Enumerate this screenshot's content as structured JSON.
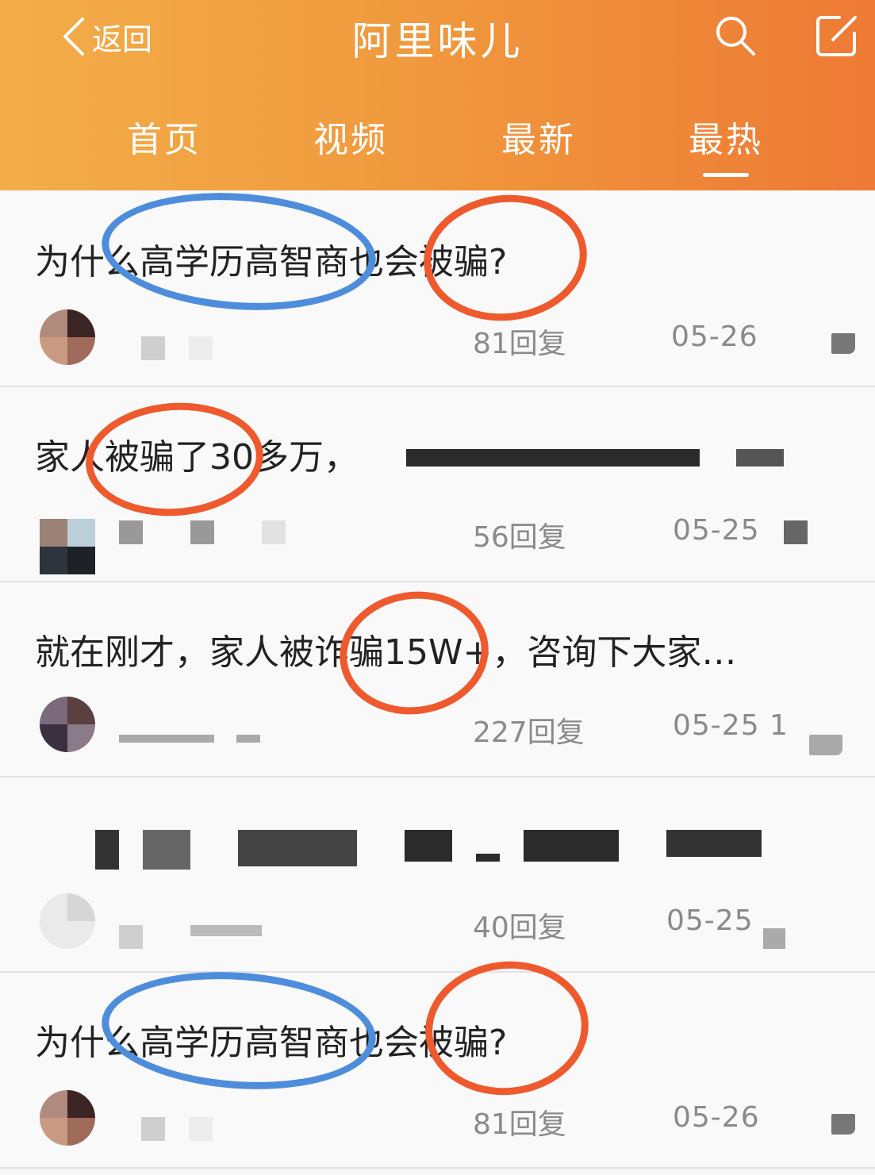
{
  "header": {
    "back_label": "返回",
    "title": "阿里味儿",
    "back_icon": "chevron-left-icon",
    "search_icon": "search-icon",
    "compose_icon": "compose-icon",
    "gradient": [
      "#f3ad48",
      "#ee7a35"
    ]
  },
  "tabs": [
    {
      "label": "首页"
    },
    {
      "label": "视频"
    },
    {
      "label": "最新"
    },
    {
      "label": "最热",
      "active": true
    }
  ],
  "posts": [
    {
      "title": "为什么高学历高智商也会被骗?",
      "replies": "81回复",
      "date": "05-26"
    },
    {
      "title": "家人被骗了30多万，",
      "replies": "56回复",
      "date": "05-25"
    },
    {
      "title": "就在刚才，家人被诈骗15W+，咨询下大家…",
      "replies": "227回复",
      "date": "05-25 1"
    },
    {
      "title": "",
      "replies": "40回复",
      "date": "05-25"
    },
    {
      "title": "为什么高学历高智商也会被骗?",
      "replies": "81回复",
      "date": "05-26"
    }
  ],
  "annotation_colors": {
    "orange": "#ee5a2d",
    "blue": "#4e8ddc"
  }
}
